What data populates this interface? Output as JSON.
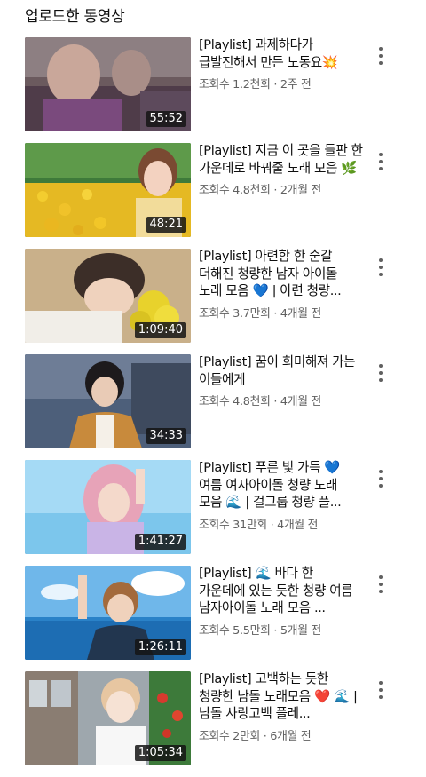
{
  "section": {
    "title": "업로드한 동영상"
  },
  "videos": [
    {
      "title": "[Playlist] 과제하다가 급발진해서 만든 노동요💥",
      "meta": "조회수 1.2천회 · 2주 전",
      "duration": "55:52"
    },
    {
      "title": "[Playlist] 지금 이 곳을 들판 한 가운데로 바꿔줄 노래 모음 🌿",
      "meta": "조회수 4.8천회 · 2개월 전",
      "duration": "48:21"
    },
    {
      "title": "[Playlist] 아련함 한 숟갈 더해진 청량한 남자 아이돌 노래 모음 💙 | 아련 청량...",
      "meta": "조회수 3.7만회 · 4개월 전",
      "duration": "1:09:40"
    },
    {
      "title": "[Playlist] 꿈이 희미해져 가는 이들에게",
      "meta": "조회수 4.8천회 · 4개월 전",
      "duration": "34:33"
    },
    {
      "title": "[Playlist] 푸른 빛 가득 💙 여름 여자아이돌 청량 노래 모음 🌊 | 걸그룹 청량 플...",
      "meta": "조회수 31만회 · 4개월 전",
      "duration": "1:41:27"
    },
    {
      "title": "[Playlist] 🌊 바다 한 가운데에 있는 듯한 청량 여름 남자아이돌 노래 모음 ...",
      "meta": "조회수 5.5만회 · 5개월 전",
      "duration": "1:26:11"
    },
    {
      "title": "[Playlist] 고백하는 듯한 청량한 남돌 노래모음 ❤️ 🌊 | 남돌 사랑고백 플레...",
      "meta": "조회수 2만회 · 6개월 전",
      "duration": "1:05:34"
    }
  ],
  "icons": {
    "more": "more-vert-icon"
  }
}
